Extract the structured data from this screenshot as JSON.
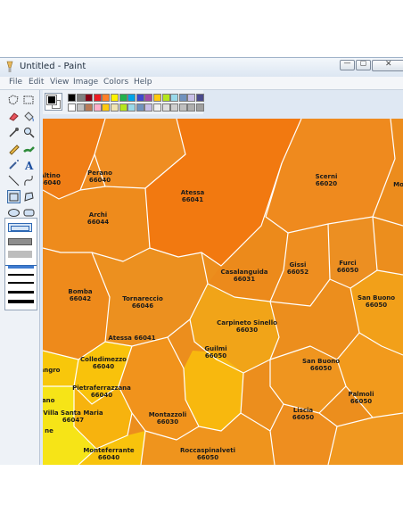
{
  "window": {
    "title": "Untitled - Paint",
    "buttons": {
      "minimize": "—",
      "maximize": "▢",
      "close": "✕"
    }
  },
  "menu": [
    "File",
    "Edit",
    "View",
    "Image",
    "Colors",
    "Help"
  ],
  "tools": [
    "free-form-select",
    "select",
    "eraser",
    "fill-with-color",
    "pick-color",
    "magnifier",
    "pencil",
    "brush",
    "airbrush",
    "text",
    "line",
    "curve",
    "rectangle",
    "polygon",
    "ellipse",
    "rounded-rectangle"
  ],
  "palette": {
    "primary": "#000000",
    "secondary": "#ffffff",
    "row1": [
      "#000000",
      "#808080",
      "#800000",
      "#808000",
      "#008000",
      "#008080",
      "#000080",
      "#800080",
      "#808040",
      "#004040",
      "#0080ff",
      "#004080",
      "#4000ff",
      "#804000"
    ],
    "row2": [
      "#ffffff",
      "#c0c0c0",
      "#ff0000",
      "#ffff00",
      "#00ff00",
      "#00ffff",
      "#0000ff",
      "#ff00ff",
      "#ffff80",
      "#00ff80",
      "#80ffff",
      "#8080ff",
      "#ff0080",
      "#ff8040"
    ]
  },
  "palette_visible": {
    "row1": [
      "#000000",
      "#7f7f7f",
      "#880015",
      "#ed1c24",
      "#ff7f27",
      "#fff200",
      "#22b14c",
      "#00a2e8",
      "#3f48cc",
      "#a349a4",
      "#ffc90e",
      "#b5e61d",
      "#99d9ea",
      "#7092be",
      "#c8bfe7",
      "#4b4b8c"
    ],
    "row2": [
      "#ffffff",
      "#c3c3c3",
      "#b97a57",
      "#ffaec9",
      "#ffc90e",
      "#efe4b0",
      "#b5e61d",
      "#99d9ea",
      "#7092be",
      "#c8bfe7",
      "#efefef",
      "#dfdfdf",
      "#cfcfcf",
      "#bfbfbf",
      "#afafaf",
      "#9f9f9f"
    ]
  },
  "map": {
    "municipalities": [
      {
        "name": "Altino",
        "code": "66040"
      },
      {
        "name": "Perano",
        "code": "66040"
      },
      {
        "name": "Atessa",
        "code": "66041"
      },
      {
        "name": "Scerni",
        "code": "66020"
      },
      {
        "name": "Archi",
        "code": "66044"
      },
      {
        "name": "Casalanguida",
        "code": "66031"
      },
      {
        "name": "Gissi",
        "code": "66052"
      },
      {
        "name": "Furci",
        "code": "66050"
      },
      {
        "name": "Bomba",
        "code": "66042"
      },
      {
        "name": "Tornareccio",
        "code": "66046"
      },
      {
        "name": "San Buono",
        "code": "66050"
      },
      {
        "name": "Carpineto Sinello",
        "code": "66030"
      },
      {
        "name": "Guilmi",
        "code": "66050"
      },
      {
        "name": "Colledimezzo",
        "code": "66040"
      },
      {
        "name": "San Buono",
        "code": "66050"
      },
      {
        "name": "Pietraferrazzana",
        "code": "66040"
      },
      {
        "name": "Palmoli",
        "code": "66050"
      },
      {
        "name": "Villa Santa Maria",
        "code": "66047"
      },
      {
        "name": "Montazzoli",
        "code": "66030"
      },
      {
        "name": "Liscia",
        "code": "66050"
      },
      {
        "name": "Monteferrante",
        "code": "66040"
      },
      {
        "name": "Roccaspinalveti",
        "code": "66050"
      }
    ],
    "partial_labels": [
      "Mo",
      "Atessa 66041",
      "angro",
      "iano",
      "ne"
    ]
  }
}
